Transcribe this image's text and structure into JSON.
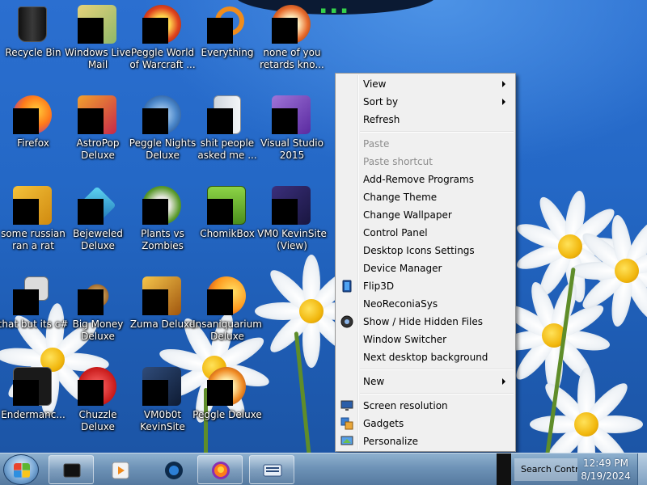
{
  "desktop": {
    "icons": [
      {
        "label": "Recycle Bin",
        "icon": "recycle-bin-icon"
      },
      {
        "label": "Windows Live\nMail",
        "icon": "mail-icon"
      },
      {
        "label": "Peggle World\nof Warcraft ...",
        "icon": "peggle-icon"
      },
      {
        "label": "Everything",
        "icon": "search-ring-icon"
      },
      {
        "label": "none of you\nretards kno...",
        "icon": "game-icon"
      },
      {
        "label": "Firefox",
        "icon": "firefox-icon"
      },
      {
        "label": "AstroPop\nDeluxe",
        "icon": "astropop-icon"
      },
      {
        "label": "Peggle Nights\nDeluxe",
        "icon": "peggle-nights-icon"
      },
      {
        "label": "shit people\nasked me ...",
        "icon": "document-icon"
      },
      {
        "label": "Visual Studio\n2015",
        "icon": "visual-studio-icon"
      },
      {
        "label": "some russian\nran a rat",
        "icon": "app-icon"
      },
      {
        "label": "Bejeweled\nDeluxe",
        "icon": "bejeweled-icon"
      },
      {
        "label": "Plants vs\nZombies",
        "icon": "plants-icon"
      },
      {
        "label": "ChomikBox",
        "icon": "chomikbox-icon"
      },
      {
        "label": "VM0 KevinSite\n(View)",
        "icon": "vm-icon"
      },
      {
        "label": "that but its c#",
        "icon": "stack-icon"
      },
      {
        "label": "Big Money\nDeluxe",
        "icon": "money-icon"
      },
      {
        "label": "Zuma Deluxe",
        "icon": "zuma-icon"
      },
      {
        "label": "Insaniquarium\nDeluxe",
        "icon": "fish-icon"
      },
      {
        "label": "Endermanc...",
        "icon": "terminal-icon"
      },
      {
        "label": "Chuzzle\nDeluxe",
        "icon": "chuzzle-icon"
      },
      {
        "label": "VM0b0t\nKevinSite",
        "icon": "vm-icon"
      },
      {
        "label": "Peggle Deluxe",
        "icon": "peggle-icon"
      }
    ]
  },
  "context_menu": {
    "view": "View",
    "sort_by": "Sort by",
    "refresh": "Refresh",
    "paste": "Paste",
    "paste_shortcut": "Paste shortcut",
    "add_remove": "Add-Remove Programs",
    "change_theme": "Change Theme",
    "change_wallpaper": "Change Wallpaper",
    "control_panel": "Control Panel",
    "desktop_icons": "Desktop Icons Settings",
    "device_manager": "Device Manager",
    "flip3d": "Flip3D",
    "neoreconia": "NeoReconiaSys",
    "show_hide": "Show / Hide Hidden Files",
    "window_switcher": "Window Switcher",
    "next_bg": "Next desktop background",
    "new": "New",
    "screen_resolution": "Screen resolution",
    "gadgets": "Gadgets",
    "personalize": "Personalize"
  },
  "taskbar": {
    "search_text": "Search Contro",
    "time": "12:49 PM",
    "date": "8/19/2024",
    "pinned": [
      "console-icon",
      "media-player-icon",
      "globe-icon",
      "firefox-icon",
      "keyboard-icon"
    ]
  },
  "colors": {
    "menu_bg": "#f0f0f0",
    "disabled_text": "#8d8d8d",
    "taskbar_top": "#8fb1cf"
  }
}
